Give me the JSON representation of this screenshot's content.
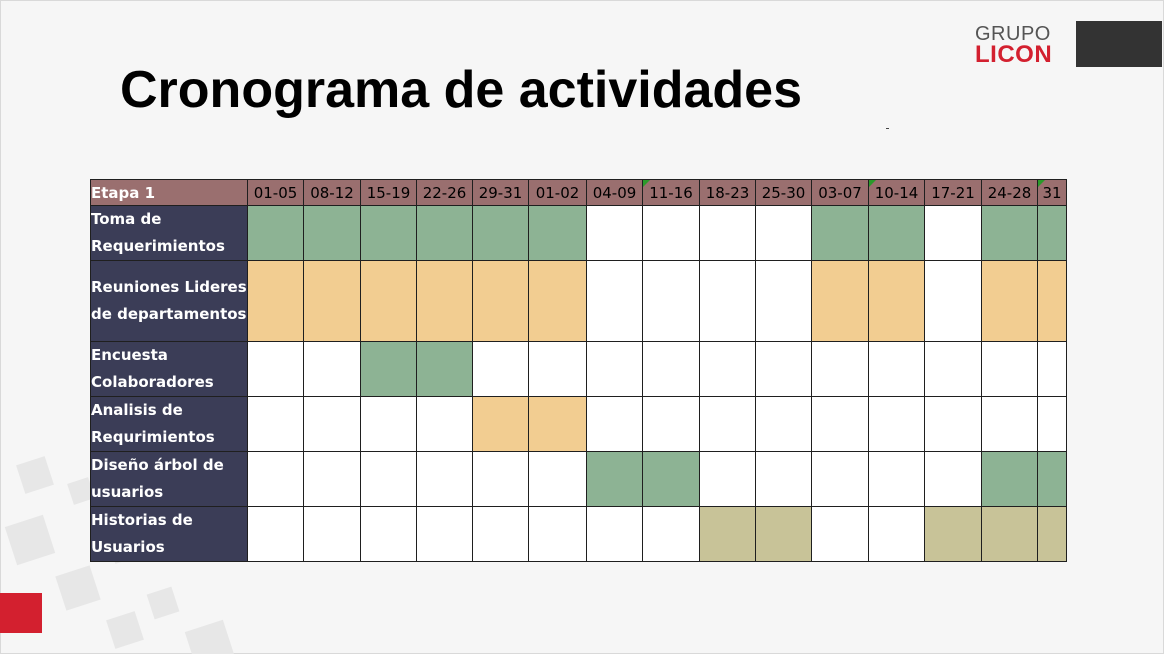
{
  "logo": {
    "line1": "GRUPO",
    "line2": "LICON"
  },
  "title": "Cronograma de actividades",
  "colors": {
    "green": "#8db394",
    "orange": "#f2cd91",
    "khaki": "#c8c398",
    "header": "#9a6f6f",
    "stage": "#3b3d57",
    "brand_red": "#d3202f"
  },
  "table": {
    "stage_header": "Etapa 1",
    "weeks": [
      "01-05",
      "08-12",
      "15-19",
      "22-26",
      "29-31",
      "01-02",
      "04-09",
      "11-16",
      "18-23",
      "25-30",
      "03-07",
      "10-14",
      "17-21",
      "24-28",
      "31"
    ],
    "flagged_weeks": [
      7,
      11,
      14
    ],
    "rows": [
      {
        "label": "Toma de Requerimientos",
        "cells": [
          "g",
          "g",
          "g",
          "g",
          "g",
          "g",
          "",
          "",
          "",
          "",
          "g",
          "g",
          "",
          "g",
          "g"
        ]
      },
      {
        "label": "Reuniones Lideres de departamentos",
        "cells": [
          "o",
          "o",
          "o",
          "o",
          "o",
          "o",
          "",
          "",
          "",
          "",
          "o",
          "o",
          "",
          "o",
          "o"
        ]
      },
      {
        "label": "Encuesta Colaboradores",
        "cells": [
          "",
          "",
          "g",
          "g",
          "",
          "",
          "",
          "",
          "",
          "",
          "",
          "",
          "",
          "",
          ""
        ]
      },
      {
        "label": "Analisis de Requrimientos",
        "cells": [
          "",
          "",
          "",
          "",
          "o",
          "o",
          "",
          "",
          "",
          "",
          "",
          "",
          "",
          "",
          ""
        ]
      },
      {
        "label": "Diseño árbol de usuarios",
        "cells": [
          "",
          "",
          "",
          "",
          "",
          "",
          "g",
          "g",
          "",
          "",
          "",
          "",
          "",
          "g",
          "g"
        ]
      },
      {
        "label": "Historias de Usuarios",
        "cells": [
          "",
          "",
          "",
          "",
          "",
          "",
          "",
          "",
          "k",
          "k",
          "",
          "",
          "k",
          "k",
          "k"
        ]
      }
    ]
  }
}
